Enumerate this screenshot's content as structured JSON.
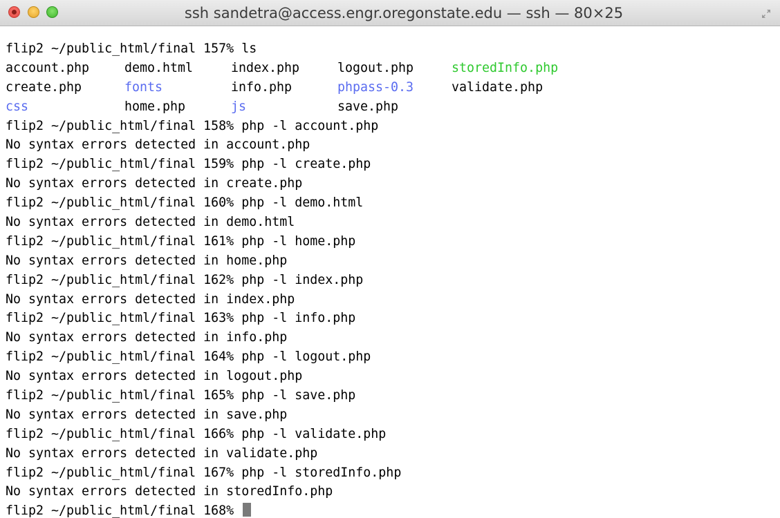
{
  "window": {
    "title": "ssh sandetra@access.engr.oregonstate.edu — ssh — 80×25"
  },
  "colors": {
    "directory": "#5a6cf0",
    "executable": "#2fc92f",
    "text": "#000000"
  },
  "terminal": {
    "ls_command": "flip2 ~/public_html/final 157% ls",
    "ls_rows": [
      [
        {
          "name": "account.php",
          "type": "file"
        },
        {
          "name": "demo.html",
          "type": "file"
        },
        {
          "name": "index.php",
          "type": "file"
        },
        {
          "name": "logout.php",
          "type": "file"
        },
        {
          "name": "storedInfo.php",
          "type": "executable"
        }
      ],
      [
        {
          "name": "create.php",
          "type": "file"
        },
        {
          "name": "fonts",
          "type": "directory"
        },
        {
          "name": "info.php",
          "type": "file"
        },
        {
          "name": "phpass-0.3",
          "type": "directory"
        },
        {
          "name": "validate.php",
          "type": "file"
        }
      ],
      [
        {
          "name": "css",
          "type": "directory"
        },
        {
          "name": "home.php",
          "type": "file"
        },
        {
          "name": "js",
          "type": "directory"
        },
        {
          "name": "save.php",
          "type": "file"
        },
        {
          "name": "",
          "type": "file"
        }
      ]
    ],
    "lines": [
      "flip2 ~/public_html/final 158% php -l account.php",
      "No syntax errors detected in account.php",
      "flip2 ~/public_html/final 159% php -l create.php",
      "No syntax errors detected in create.php",
      "flip2 ~/public_html/final 160% php -l demo.html",
      "No syntax errors detected in demo.html",
      "flip2 ~/public_html/final 161% php -l home.php",
      "No syntax errors detected in home.php",
      "flip2 ~/public_html/final 162% php -l index.php",
      "No syntax errors detected in index.php",
      "flip2 ~/public_html/final 163% php -l info.php",
      "No syntax errors detected in info.php",
      "flip2 ~/public_html/final 164% php -l logout.php",
      "No syntax errors detected in logout.php",
      "flip2 ~/public_html/final 165% php -l save.php",
      "No syntax errors detected in save.php",
      "flip2 ~/public_html/final 166% php -l validate.php",
      "No syntax errors detected in validate.php",
      "flip2 ~/public_html/final 167% php -l storedInfo.php",
      "No syntax errors detected in storedInfo.php"
    ],
    "prompt": "flip2 ~/public_html/final 168% "
  }
}
